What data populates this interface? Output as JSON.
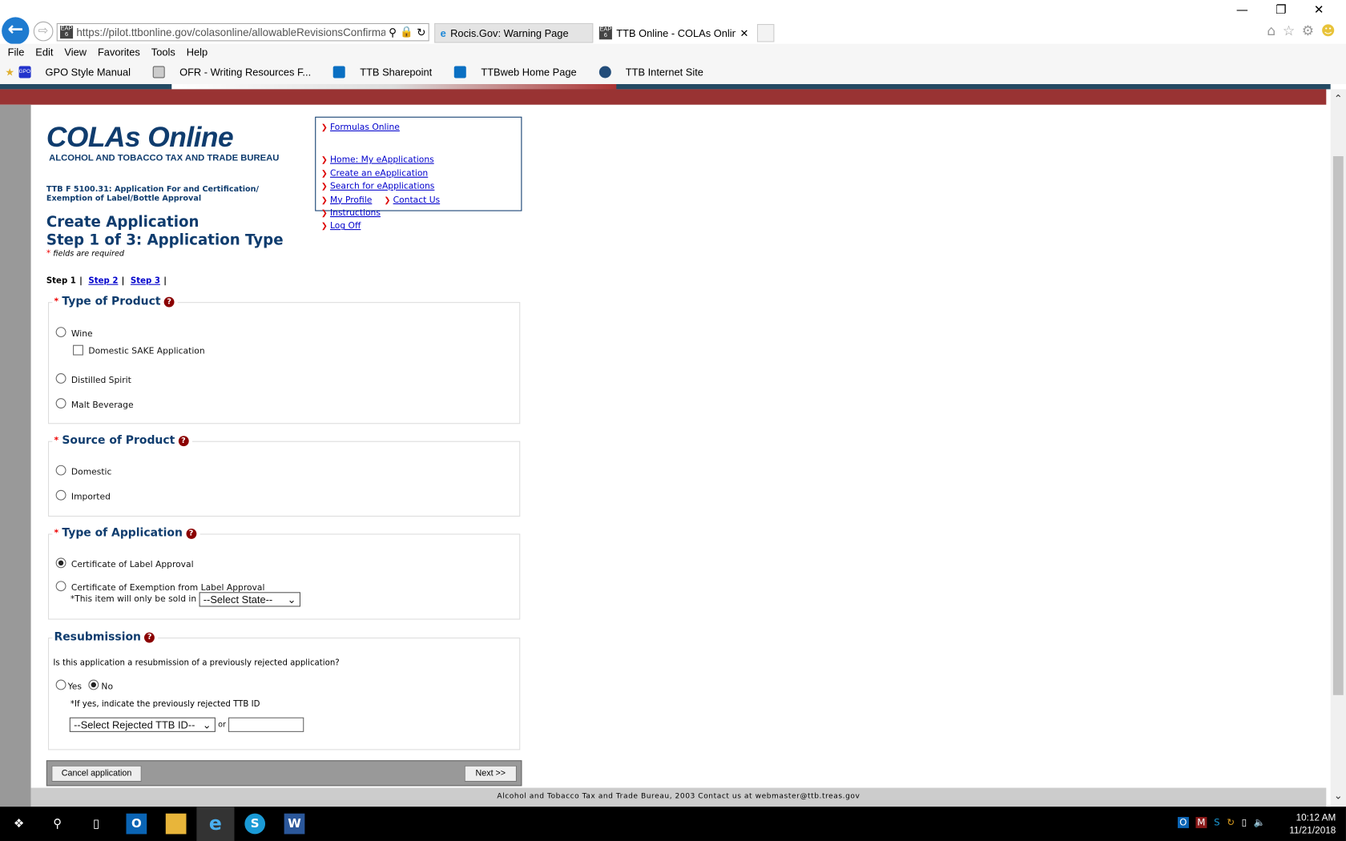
{
  "browser": {
    "url": "https://pilot.ttbonline.gov/colasonline/allowableRevisionsConfirmatio",
    "tabs": [
      {
        "label": "Rocis.Gov: Warning Page",
        "active": false
      },
      {
        "label": "TTB Online - COLAs Online ...",
        "active": true
      }
    ],
    "menu": [
      "File",
      "Edit",
      "View",
      "Favorites",
      "Tools",
      "Help"
    ],
    "favorites": [
      "GPO Style Manual",
      "OFR - Writing Resources F...",
      "TTB Sharepoint",
      "TTBweb Home Page",
      "TTB Internet Site"
    ],
    "favicon_label": "GPO",
    "eap_badge": "EAP 6"
  },
  "header": {
    "logo_title": "COLAs Online",
    "logo_subtitle": "ALCOHOL AND TOBACCO TAX AND TRADE BUREAU",
    "form_line1": "TTB F 5100.31: Application For and Certification/",
    "form_line2": "Exemption of Label/Bottle Approval",
    "title1": "Create Application",
    "title2": "Step 1 of 3: Application Type",
    "required_note": "fields are required"
  },
  "nav": {
    "formulas": "Formulas Online",
    "home": "Home: My eApplications",
    "create": "Create an eApplication",
    "search": "Search for eApplications",
    "profile": "My Profile",
    "contact": "Contact Us",
    "instructions": "Instructions",
    "logoff": "Log Off"
  },
  "steps": {
    "current": "Step 1",
    "step2": "Step 2",
    "step3": "Step 3",
    "sep": "|"
  },
  "product": {
    "legend": "Type of Product",
    "wine": "Wine",
    "sake": "Domestic SAKE Application",
    "spirit": "Distilled Spirit",
    "malt": "Malt Beverage"
  },
  "source": {
    "legend": "Source of Product",
    "domestic": "Domestic",
    "imported": "Imported"
  },
  "apptype": {
    "legend": "Type of Application",
    "cola": "Certificate of Label Approval",
    "exempt": "Certificate of Exemption from Label Approval",
    "state_label": "*This item will only be sold in",
    "state_select": "--Select State--",
    "selected": "Certificate of Label Approval"
  },
  "resub": {
    "legend": "Resubmission",
    "question": "Is this application a resubmission of a previously rejected application?",
    "yes": "Yes",
    "no": "No",
    "selected": "No",
    "hint": "*If yes, indicate the previously rejected TTB ID",
    "ttb_select": "--Select Rejected TTB ID--",
    "or": "or",
    "ttb_input": ""
  },
  "buttons": {
    "cancel": "Cancel application",
    "next": "Next >>"
  },
  "footer": "Alcohol and Tobacco Tax and Trade Bureau, 2003  Contact us at webmaster@ttb.treas.gov",
  "taskbar": {
    "time": "10:12 AM",
    "date": "11/21/2018"
  },
  "colors": {
    "brand_blue": "#0f3c6e",
    "banner_red": "#993333",
    "required_red": "#e00000"
  }
}
